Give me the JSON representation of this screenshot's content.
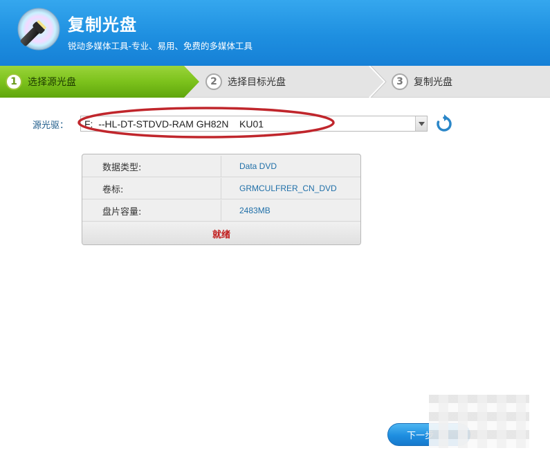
{
  "header": {
    "title": "复制光盘",
    "subtitle": "锐动多媒体工具-专业、易用、免费的多媒体工具"
  },
  "steps": [
    {
      "number": "1",
      "label": "选择源光盘",
      "state": "active"
    },
    {
      "number": "2",
      "label": "选择目标光盘",
      "state": "inactive"
    },
    {
      "number": "3",
      "label": "复制光盘",
      "state": "inactive"
    }
  ],
  "source": {
    "label": "源光驱：",
    "selected": "F:  --HL-DT-STDVD-RAM GH82N    KU01"
  },
  "disc_info": {
    "rows": [
      {
        "key": "数据类型:",
        "value": "Data DVD"
      },
      {
        "key": "卷标:",
        "value": "GRMCULFRER_CN_DVD"
      },
      {
        "key": "盘片容量:",
        "value": "2483MB"
      }
    ],
    "status": "就绪"
  },
  "footer": {
    "next_label": "下一步"
  },
  "colors": {
    "header_blue": "#1e8fe0",
    "active_step_green": "#7cc21c",
    "status_red": "#c01a1a",
    "highlight_ellipse": "#c0262c"
  },
  "icons": {
    "logo": "disc-flashlight-icon",
    "dropdown": "chevron-down-icon",
    "refresh": "refresh-icon"
  }
}
